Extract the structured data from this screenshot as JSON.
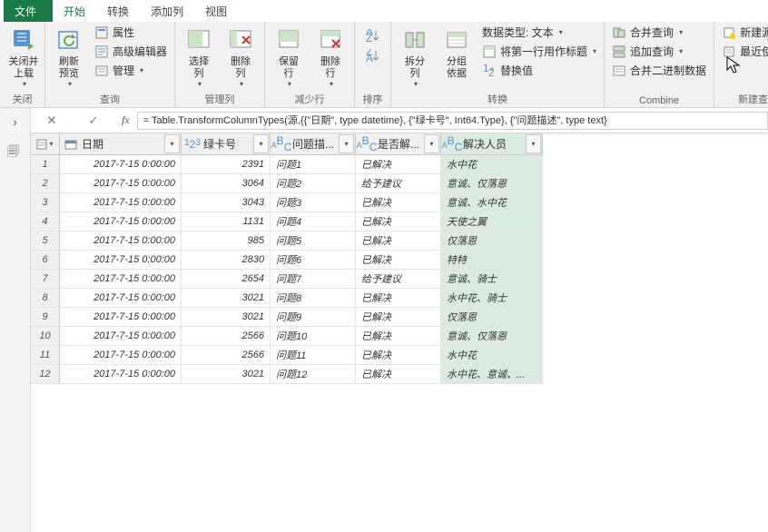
{
  "tabs": {
    "file": "文件",
    "home": "开始",
    "transform": "转换",
    "addcol": "添加列",
    "view": "视图"
  },
  "ribbon": {
    "close": {
      "group": "关闭",
      "closeLoad": "关闭并\n上载"
    },
    "query": {
      "group": "查询",
      "refresh": "刷新\n预览",
      "props": "属性",
      "advEditor": "高级编辑器",
      "manage": "管理"
    },
    "manageCols": {
      "group": "管理列",
      "choose": "选择\n列",
      "remove": "删除\n列"
    },
    "reduceRows": {
      "group": "减少行",
      "keep": "保留\n行",
      "remove2": "删除\n行"
    },
    "sort": {
      "group": "排序"
    },
    "transform": {
      "group": "转换",
      "split": "拆分\n列",
      "groupby": "分组\n依据",
      "dataType": "数据类型: 文本",
      "firstRowHeader": "将第一行用作标题",
      "replace": "替换值"
    },
    "combine": {
      "group": "Combine",
      "merge": "合并查询",
      "append": "追加查询",
      "binary": "合并二进制数据"
    },
    "newq": {
      "group": "新建查询",
      "newsource": "新建源",
      "recent": "最近使用的"
    }
  },
  "formula": "= Table.TransformColumnTypes(源,{{\"日期\", type datetime}, {\"绿卡号\", Int64.Type}, {\"问题描述\", type text}",
  "columns": {
    "date": "日期",
    "card": "绿卡号",
    "desc": "问题描...",
    "solved": "是否解...",
    "person": "解决人员"
  },
  "typeLabels": {
    "date": "",
    "num": "1₂3",
    "txt": "ABC"
  },
  "rows": [
    {
      "n": "1",
      "date": "2017-7-15 0:00:00",
      "card": "2391",
      "desc": "问题1",
      "solved": "已解决",
      "person": "水中花"
    },
    {
      "n": "2",
      "date": "2017-7-15 0:00:00",
      "card": "3064",
      "desc": "问题2",
      "solved": "给予建议",
      "person": "意诚、仅落恩"
    },
    {
      "n": "3",
      "date": "2017-7-15 0:00:00",
      "card": "3043",
      "desc": "问题3",
      "solved": "已解决",
      "person": "意诚、水中花"
    },
    {
      "n": "4",
      "date": "2017-7-15 0:00:00",
      "card": "1131",
      "desc": "问题4",
      "solved": "已解决",
      "person": "天使之翼"
    },
    {
      "n": "5",
      "date": "2017-7-15 0:00:00",
      "card": "985",
      "desc": "问题5",
      "solved": "已解决",
      "person": "仅落恩"
    },
    {
      "n": "6",
      "date": "2017-7-15 0:00:00",
      "card": "2830",
      "desc": "问题6",
      "solved": "已解决",
      "person": "特特"
    },
    {
      "n": "7",
      "date": "2017-7-15 0:00:00",
      "card": "2654",
      "desc": "问题7",
      "solved": "给予建议",
      "person": "意诚、骑士"
    },
    {
      "n": "8",
      "date": "2017-7-15 0:00:00",
      "card": "3021",
      "desc": "问题8",
      "solved": "已解决",
      "person": "水中花、骑士"
    },
    {
      "n": "9",
      "date": "2017-7-15 0:00:00",
      "card": "3021",
      "desc": "问题9",
      "solved": "已解决",
      "person": "仅落恩"
    },
    {
      "n": "10",
      "date": "2017-7-15 0:00:00",
      "card": "2566",
      "desc": "问题10",
      "solved": "已解决",
      "person": "意诚、仅落恩"
    },
    {
      "n": "11",
      "date": "2017-7-15 0:00:00",
      "card": "2566",
      "desc": "问题11",
      "solved": "已解决",
      "person": "水中花"
    },
    {
      "n": "12",
      "date": "2017-7-15 0:00:00",
      "card": "3021",
      "desc": "问题12",
      "solved": "已解决",
      "person": "水中花、意诚、..."
    }
  ]
}
